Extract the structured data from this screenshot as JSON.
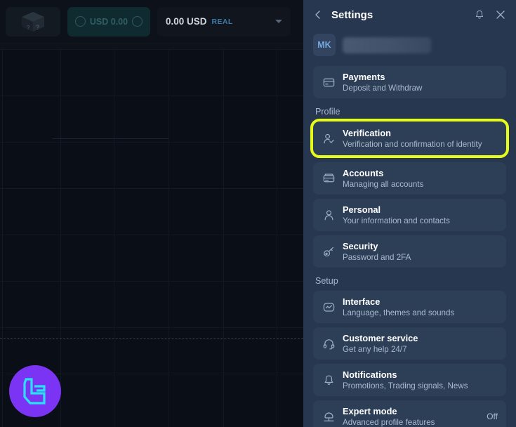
{
  "trading": {
    "box_button": {
      "icon": "mystery-box-icon",
      "label": ""
    },
    "bonus_pill": {
      "amount": "USD 0.00",
      "left_icon": "coin-icon",
      "right_icon": "coin-icon"
    },
    "balance": {
      "amount": "0.00 USD",
      "account_type": "REAL",
      "caret": "chevron-down-icon"
    },
    "logo": {
      "name": "brand-logo",
      "glyph": "LC"
    }
  },
  "panel": {
    "header": {
      "back_icon": "chevron-left-icon",
      "title": "Settings",
      "bell_icon": "bell-icon",
      "close_icon": "close-icon"
    },
    "profile": {
      "avatar_initials": "MK",
      "name_redacted": true
    },
    "groups": [
      {
        "label": "",
        "items": [
          {
            "icon": "credit-card-icon",
            "title": "Payments",
            "subtitle": "Deposit and Withdraw",
            "status": "",
            "highlighted": false
          }
        ]
      },
      {
        "label": "Profile",
        "items": [
          {
            "icon": "user-check-icon",
            "title": "Verification",
            "subtitle": "Verification and confirmation of identity",
            "status": "",
            "highlighted": true
          },
          {
            "icon": "accounts-icon",
            "title": "Accounts",
            "subtitle": "Managing all accounts",
            "status": "",
            "highlighted": false
          },
          {
            "icon": "user-icon",
            "title": "Personal",
            "subtitle": "Your information and contacts",
            "status": "",
            "highlighted": false
          },
          {
            "icon": "key-icon",
            "title": "Security",
            "subtitle": "Password and 2FA",
            "status": "",
            "highlighted": false
          }
        ]
      },
      {
        "label": "Setup",
        "items": [
          {
            "icon": "interface-icon",
            "title": "Interface",
            "subtitle": "Language, themes and sounds",
            "status": "",
            "highlighted": false
          },
          {
            "icon": "headset-icon",
            "title": "Customer service",
            "subtitle": "Get any help 24/7",
            "status": "",
            "highlighted": false
          },
          {
            "icon": "bell-icon",
            "title": "Notifications",
            "subtitle": "Promotions, Trading signals, News",
            "status": "",
            "highlighted": false
          },
          {
            "icon": "graduation-cap-icon",
            "title": "Expert mode",
            "subtitle": "Advanced profile features",
            "status": "Off",
            "highlighted": false
          }
        ]
      }
    ]
  },
  "colors": {
    "panel_bg": "#27374f",
    "item_bg": "#2d3e57",
    "highlight": "#e7fb18",
    "accent_blue": "#74a9dd",
    "logo_purple": "#7c34f4",
    "logo_cyan": "#29e0f5"
  }
}
